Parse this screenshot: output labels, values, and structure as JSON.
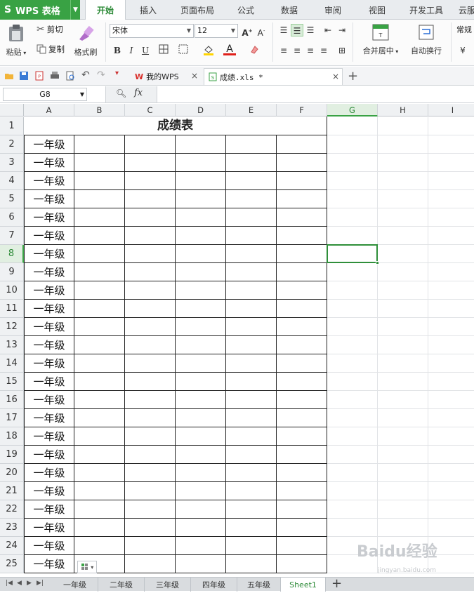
{
  "app": {
    "logo": "S",
    "title": "WPS 表格",
    "accent": "#39a244"
  },
  "menu_tabs": [
    {
      "label": "开始",
      "active": true
    },
    {
      "label": "插入"
    },
    {
      "label": "页面布局"
    },
    {
      "label": "公式"
    },
    {
      "label": "数据"
    },
    {
      "label": "审阅"
    },
    {
      "label": "视图"
    },
    {
      "label": "开发工具"
    },
    {
      "label": "云服"
    }
  ],
  "ribbon": {
    "paste": "粘贴",
    "cut": "剪切",
    "copy": "复制",
    "format_painter": "格式刷",
    "font_name": "宋体",
    "font_size": "12",
    "merge_center": "合并居中",
    "wrap_text": "自动换行",
    "number_format": "常规"
  },
  "doc_tabs": [
    {
      "label": "我的WPS",
      "active": false
    },
    {
      "label": "成绩.xls *",
      "active": true
    }
  ],
  "formula_bar": {
    "cell_ref": "G8",
    "fx": "fx",
    "value": ""
  },
  "columns": [
    "A",
    "B",
    "C",
    "D",
    "E",
    "F",
    "G",
    "H",
    "I"
  ],
  "selected_column": "G",
  "selected_row": 8,
  "sheet": {
    "title": "成绩表",
    "rows": [
      {
        "row": 1,
        "a": ""
      },
      {
        "row": 2,
        "a": "一年级"
      },
      {
        "row": 3,
        "a": "一年级"
      },
      {
        "row": 4,
        "a": "一年级"
      },
      {
        "row": 5,
        "a": "一年级"
      },
      {
        "row": 6,
        "a": "一年级"
      },
      {
        "row": 7,
        "a": "一年级"
      },
      {
        "row": 8,
        "a": "一年级"
      },
      {
        "row": 9,
        "a": "一年级"
      },
      {
        "row": 10,
        "a": "一年级"
      },
      {
        "row": 11,
        "a": "一年级"
      },
      {
        "row": 12,
        "a": "一年级"
      },
      {
        "row": 13,
        "a": "一年级"
      },
      {
        "row": 14,
        "a": "一年级"
      },
      {
        "row": 15,
        "a": "一年级"
      },
      {
        "row": 16,
        "a": "一年级"
      },
      {
        "row": 17,
        "a": "一年级"
      },
      {
        "row": 18,
        "a": "一年级"
      },
      {
        "row": 19,
        "a": "一年级"
      },
      {
        "row": 20,
        "a": "一年级"
      },
      {
        "row": 21,
        "a": "一年级"
      },
      {
        "row": 22,
        "a": "一年级"
      },
      {
        "row": 23,
        "a": "一年级"
      },
      {
        "row": 24,
        "a": "一年级"
      },
      {
        "row": 25,
        "a": "一年级"
      }
    ]
  },
  "sheet_tabs": [
    {
      "label": "一年级",
      "active": false
    },
    {
      "label": "二年级",
      "active": false
    },
    {
      "label": "三年级",
      "active": false
    },
    {
      "label": "四年级",
      "active": false
    },
    {
      "label": "五年级",
      "active": false
    },
    {
      "label": "Sheet1",
      "active": true
    }
  ],
  "watermark": {
    "text": "Baidu经验",
    "sub": "jingyan.baidu.com"
  }
}
